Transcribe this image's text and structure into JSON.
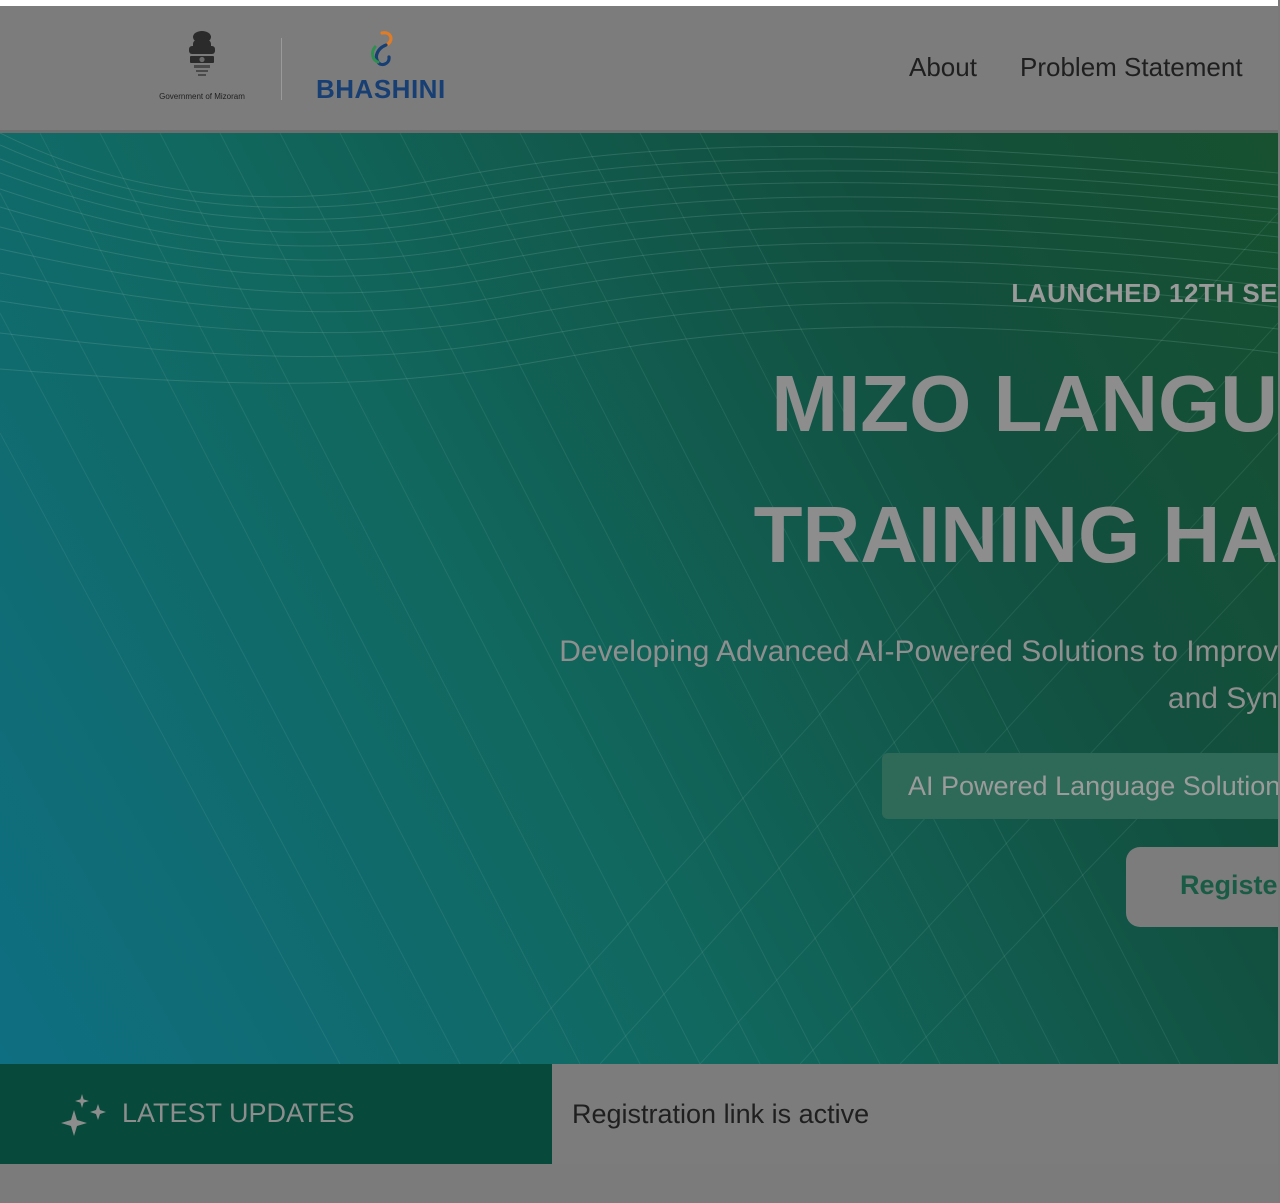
{
  "header": {
    "gov_caption": "Government of Mizoram",
    "brand_name": "BHASHINI",
    "nav": [
      "About",
      "Problem Statement"
    ]
  },
  "hero": {
    "launch": "LAUNCHED 12TH SE",
    "title_line1": "MIZO LANGU",
    "title_line2": "TRAINING HA",
    "subtitle_line1": "Developing Advanced AI-Powered Solutions to Improv",
    "subtitle_line2": "and Syn",
    "pill_text": "AI Powered Language Solution",
    "register_label": "Registe"
  },
  "updates": {
    "label": "LATEST UPDATES",
    "ticker": "Registration link is active"
  },
  "colors": {
    "accent_green": "#074a3b",
    "brand_blue": "#173f73",
    "hero_start": "#0f6f82",
    "hero_end": "#175130"
  },
  "icons": [
    "ashoka-emblem-icon",
    "bhashini-logo-icon",
    "sparkles-icon"
  ]
}
